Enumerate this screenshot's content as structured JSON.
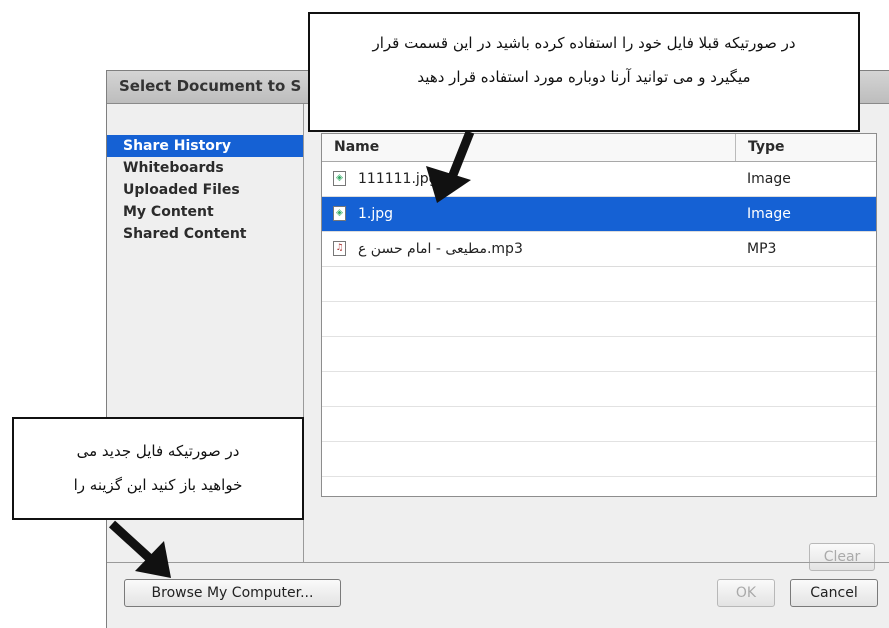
{
  "dialog": {
    "title": "Select Document to S",
    "sidebar": [
      {
        "label": "Share History",
        "selected": true
      },
      {
        "label": "Whiteboards",
        "selected": false
      },
      {
        "label": "Uploaded Files",
        "selected": false
      },
      {
        "label": "My Content",
        "selected": false
      },
      {
        "label": "Shared Content",
        "selected": false
      }
    ],
    "table": {
      "col_name": "Name",
      "col_type": "Type",
      "rows": [
        {
          "name": "111111.jpg",
          "type": "Image",
          "icon": "image-file-icon",
          "selected": false
        },
        {
          "name": "1.jpg",
          "type": "Image",
          "icon": "image-file-icon",
          "selected": true
        },
        {
          "name": "مطیعی - امام حسن ع.mp3",
          "type": "MP3",
          "icon": "audio-file-icon",
          "selected": false
        }
      ]
    },
    "buttons": {
      "clear": "Clear",
      "browse": "Browse My Computer...",
      "ok": "OK",
      "cancel": "Cancel"
    }
  },
  "annotations": {
    "top_line1": "در صورتیکه قبلا فایل خود را استفاده کرده باشید در این قسمت قرار",
    "top_line2": "میگیرد و می توانید آرنا دوباره مورد استفاده قرار دهید",
    "left_line1": "در صورتیکه فایل جدید می",
    "left_line2": "خواهید باز کنید این گزینه را"
  },
  "colors": {
    "selection": "#1561d4"
  }
}
